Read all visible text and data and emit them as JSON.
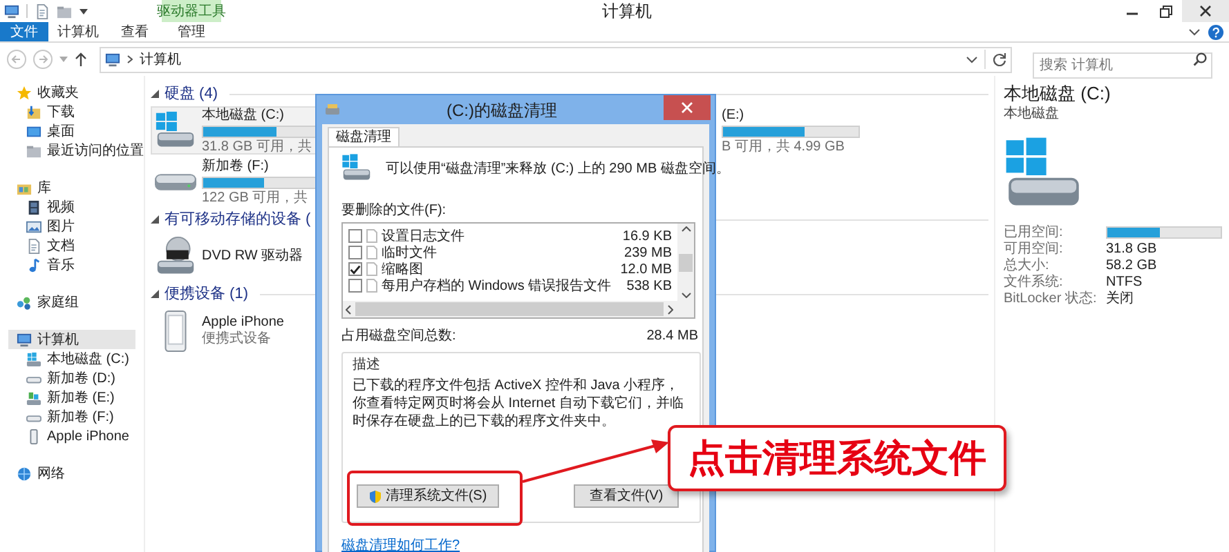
{
  "window": {
    "title": "计算机",
    "context_tab": "驱动器工具"
  },
  "ribbon_tabs": [
    {
      "label": "文件",
      "kind": "file"
    },
    {
      "label": "计算机",
      "kind": "tab"
    },
    {
      "label": "查看",
      "kind": "tab"
    },
    {
      "label": "管理",
      "kind": "tab"
    }
  ],
  "address": {
    "path": "计算机"
  },
  "search": {
    "placeholder": "搜索 计算机"
  },
  "nav": [
    {
      "label": "收藏夹",
      "selected": false,
      "children": [
        {
          "label": "下载",
          "selected": false
        },
        {
          "label": "桌面",
          "selected": false
        },
        {
          "label": "最近访问的位置",
          "selected": false
        }
      ]
    },
    {
      "label": "库",
      "selected": false,
      "children": [
        {
          "label": "视频",
          "selected": false
        },
        {
          "label": "图片",
          "selected": false
        },
        {
          "label": "文档",
          "selected": false
        },
        {
          "label": "音乐",
          "selected": false
        }
      ]
    },
    {
      "label": "家庭组",
      "selected": false
    },
    {
      "label": "计算机",
      "selected": true,
      "children": [
        {
          "label": "本地磁盘 (C:)",
          "selected": false
        },
        {
          "label": "新加卷 (D:)",
          "selected": false
        },
        {
          "label": "新加卷 (E:)",
          "selected": false
        },
        {
          "label": "新加卷 (F:)",
          "selected": false
        },
        {
          "label": "Apple iPhone",
          "selected": false
        }
      ]
    },
    {
      "label": "网络",
      "selected": false
    }
  ],
  "groups": [
    {
      "title": "硬盘 (4)",
      "items": [
        {
          "kind": "system_drive",
          "label": "本地磁盘 (C:)",
          "level": 0.45,
          "caption": "31.8 GB 可用，共",
          "selected": true
        },
        {
          "kind": "clipped_drive",
          "label": "(E:)",
          "level": 0.6,
          "caption": "B 可用，共 4.99 GB",
          "selected": false
        },
        {
          "kind": "drive",
          "label": "新加卷 (F:)",
          "level": 0.37,
          "caption": "122 GB 可用，共",
          "selected": false
        }
      ]
    },
    {
      "title": "有可移动存储的设备 (",
      "items": [
        {
          "kind": "dvd",
          "label": "DVD RW 驱动器",
          "selected": false
        }
      ]
    },
    {
      "title": "便携设备 (1)",
      "items": [
        {
          "kind": "portable",
          "label": "Apple iPhone",
          "caption": "便携式设备",
          "selected": false
        }
      ]
    }
  ],
  "details": {
    "title": "本地磁盘 (C:)",
    "subtitle": "本地磁盘",
    "rows": [
      {
        "kind": "bar",
        "label": "已用空间:",
        "level": 0.46
      },
      {
        "kind": "text",
        "label": "可用空间:",
        "value": "31.8 GB"
      },
      {
        "kind": "text",
        "label": "总大小:",
        "value": "58.2 GB"
      },
      {
        "kind": "text",
        "label": "文件系统:",
        "value": "NTFS"
      },
      {
        "kind": "text",
        "label": "BitLocker 状态:",
        "value": "关闭"
      }
    ]
  },
  "dialog": {
    "title": "(C:)的磁盘清理",
    "tab": "磁盘清理",
    "summary": "可以使用“磁盘清理”来释放 (C:) 上的 290 MB 磁盘空间。",
    "files_label": "要删除的文件(F):",
    "files": [
      {
        "name": "设置日志文件",
        "size": "16.9 KB",
        "checked": false
      },
      {
        "name": "临时文件",
        "size": "239 MB",
        "checked": false
      },
      {
        "name": "缩略图",
        "size": "12.0 MB",
        "checked": true
      },
      {
        "name": "每用户存档的 Windows 错误报告文件",
        "size": "538 KB",
        "checked": false
      }
    ],
    "total_label": "占用磁盘空间总数:",
    "total": "28.4 MB",
    "description_title": "描述",
    "description": "已下载的程序文件包括 ActiveX 控件和 Java 小程序，你查看特定网页时将会从 Internet 自动下载它们，并临时保存在硬盘上的已下载的程序文件夹中。",
    "buttons": [
      {
        "label": "清理系统文件(S)",
        "kind": "shield"
      },
      {
        "label": "查看文件(V)",
        "kind": "plain"
      }
    ],
    "link": "磁盘清理如何工作?"
  },
  "annotation": {
    "text": "点击清理系统文件"
  }
}
